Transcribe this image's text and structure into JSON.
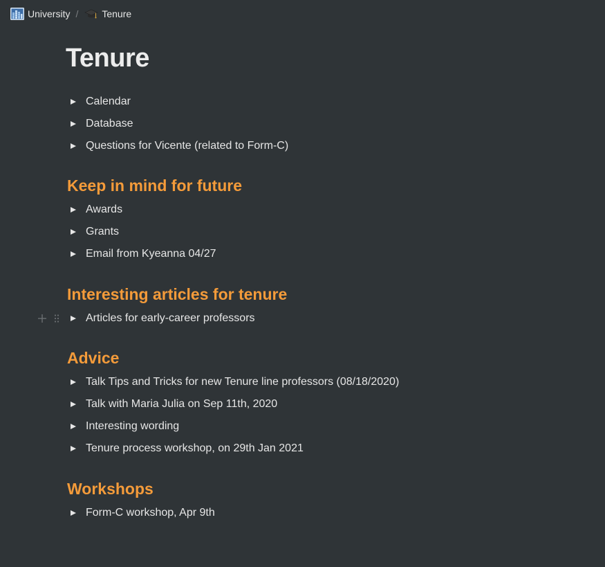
{
  "breadcrumb": {
    "workspace": {
      "label": "University",
      "icon": "buildings-icon"
    },
    "separator": "/",
    "page": {
      "label": "Tenure",
      "icon": "graduation-cap-icon"
    }
  },
  "page": {
    "title": "Tenure"
  },
  "top_toggles": [
    {
      "label": "Calendar"
    },
    {
      "label": "Database"
    },
    {
      "label": "Questions for Vicente (related to Form-C)"
    }
  ],
  "sections": [
    {
      "heading": "Keep in mind for future",
      "toggles": [
        {
          "label": "Awards"
        },
        {
          "label": "Grants"
        },
        {
          "label": "Email from Kyeanna 04/27"
        }
      ]
    },
    {
      "heading": "Interesting articles for tenure",
      "toggles": [
        {
          "label": "Articles for early-career professors"
        }
      ]
    },
    {
      "heading": "Advice",
      "toggles": [
        {
          "label": "Talk Tips and Tricks for new Tenure line professors (08/18/2020)"
        },
        {
          "label": "Talk with Maria Julia on Sep 11th, 2020"
        },
        {
          "label": "Interesting wording"
        },
        {
          "label": "Tenure process workshop, on 29th Jan 2021"
        }
      ]
    },
    {
      "heading": "Workshops",
      "toggles": [
        {
          "label": "Form-C workshop, Apr 9th"
        }
      ]
    }
  ],
  "block_handles": {
    "add": "plus-icon",
    "drag": "drag-handle-icon"
  },
  "colors": {
    "background": "#2f3437",
    "text": "#e6e6e6",
    "heading_accent": "#f49b3a",
    "muted": "#7d8083"
  }
}
